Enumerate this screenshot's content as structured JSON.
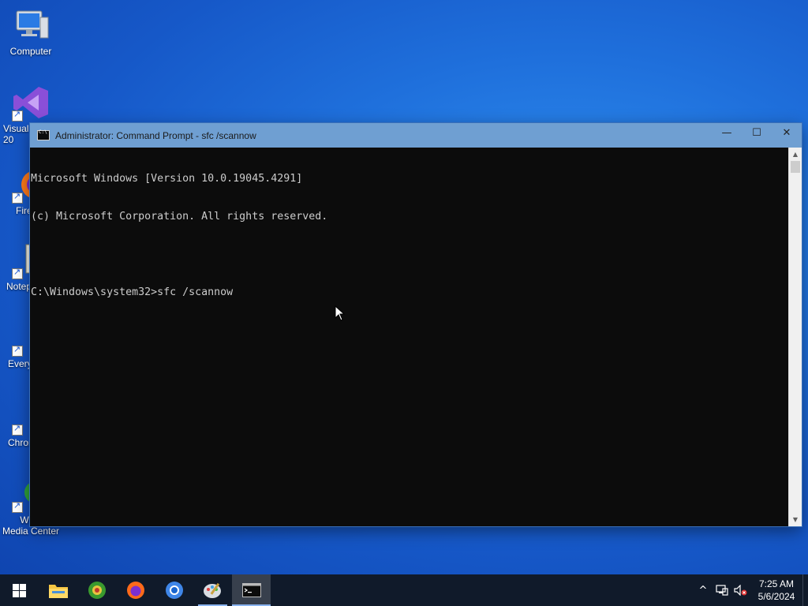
{
  "desktop": {
    "icons": [
      {
        "label": "Computer"
      },
      {
        "label": "Visual\n20"
      },
      {
        "label": "Fire"
      },
      {
        "label": "Notep"
      },
      {
        "label": "Every"
      },
      {
        "label": "Chron"
      },
      {
        "label": "Wind\nMedia Center"
      }
    ]
  },
  "window": {
    "title": "Administrator: Command Prompt - sfc  /scannow",
    "controls": {
      "minimize": "—",
      "maximize": "☐",
      "close": "✕"
    },
    "console_lines": [
      "Microsoft Windows [Version 10.0.19045.4291]",
      "(c) Microsoft Corporation. All rights reserved.",
      "",
      "C:\\Windows\\system32>sfc /scannow"
    ]
  },
  "taskbar": {
    "clock_time": "7:25 AM",
    "clock_date": "5/6/2024",
    "tray_chevron": "^"
  },
  "colors": {
    "console_bg": "#0c0c0c",
    "console_fg": "#cccccc",
    "titlebar": "#6f9fd2",
    "taskbar": "#101a2a"
  }
}
